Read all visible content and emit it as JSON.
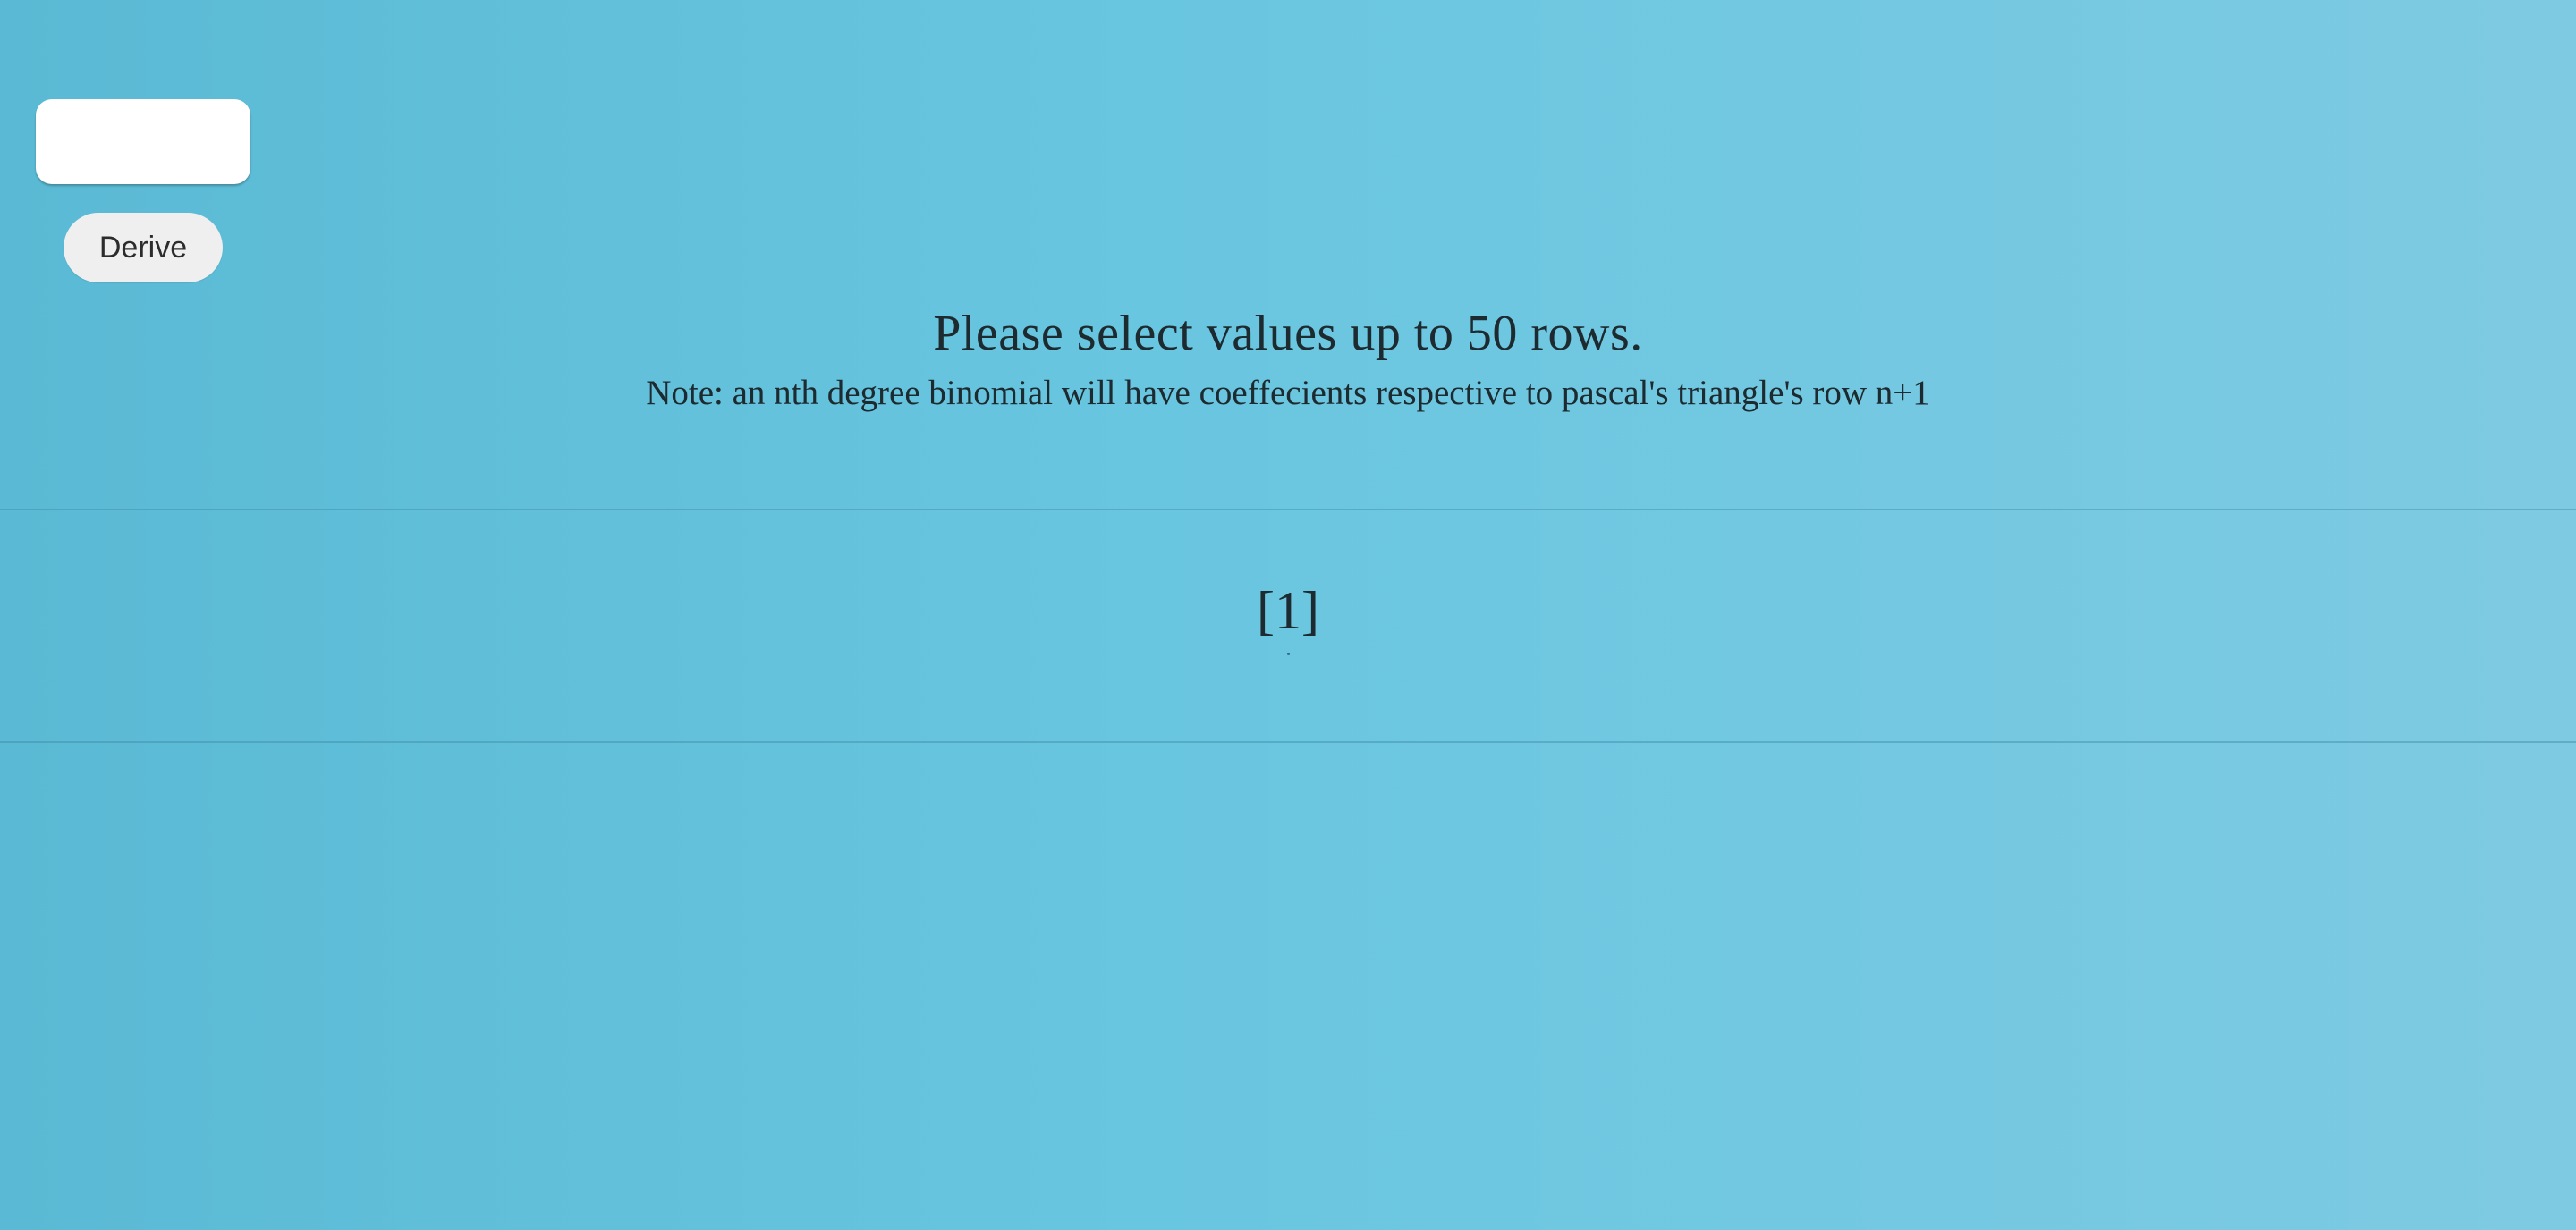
{
  "controls": {
    "row_input": {
      "value": "",
      "placeholder": ""
    },
    "derive_label": "Derive"
  },
  "messages": {
    "main": "Please select values up to 50 rows.",
    "note": "Note: an nth degree binomial will have coeffecients respective to pascal's triangle's row n+1"
  },
  "result": {
    "rows": [
      "[1]"
    ]
  },
  "colors": {
    "background_start": "#5ab9d4",
    "background_end": "#7ecae2",
    "button_bg": "#efefef",
    "input_bg": "#ffffff",
    "text": "#1d2a2f"
  }
}
